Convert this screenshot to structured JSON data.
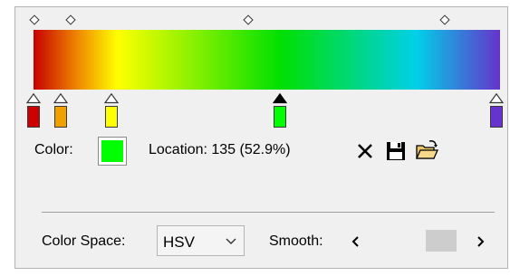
{
  "gradient": {
    "stops": [
      {
        "color": "#ff0000",
        "position_pct": 0
      },
      {
        "color": "#ffa500",
        "position_pct": 10
      },
      {
        "color": "#ffff00",
        "position_pct": 18
      },
      {
        "color": "#00ff00",
        "position_pct": 52.9
      },
      {
        "color": "#6633cc",
        "position_pct": 100
      }
    ],
    "midpoint_positions_pct": [
      5,
      12,
      45,
      88
    ]
  },
  "editor": {
    "color_label": "Color:",
    "selected_color": "#00ff00",
    "location_text": "Location: 135  (52.9%)",
    "delete_icon": "delete-x-icon",
    "save_icon": "save-disk-icon",
    "open_icon": "open-folder-icon"
  },
  "settings": {
    "color_space_label": "Color Space:",
    "color_space_value": "HSV",
    "smooth_label": "Smooth:",
    "smooth_fraction": 0.75
  },
  "colors": {
    "panel_bg": "#f0f0f0",
    "border": "#b4b4b4",
    "accent_selected": "#00ff00"
  }
}
